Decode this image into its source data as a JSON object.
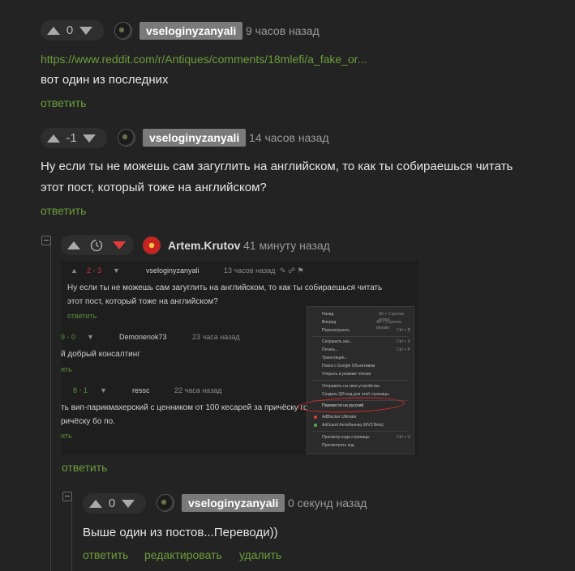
{
  "comments": [
    {
      "score": "0",
      "username": "vseloginyzanyali",
      "time": "9 часов назад",
      "link": "https://www.reddit.com/r/Antiques/comments/18mlefi/a_fake_or...",
      "text": "вот один из последних",
      "reply_label": "ответить"
    },
    {
      "score": "-1",
      "username": "vseloginyzanyali",
      "time": "14 часов назад",
      "text_line1": "Ну если ты не можешь сам загуглить на английском, то как ты собираешься читать",
      "text_line2": "этот пост, который тоже на английском?",
      "reply_label": "ответить"
    },
    {
      "username": "Artem.Krutov",
      "time": "41 минуту назад",
      "reply_label": "ответить",
      "screenshot": {
        "c1_score": "2 - 3",
        "c1_user": "vseloginyzanyali",
        "c1_time": "13 часов назад",
        "c1_l1": "Ну если ты не можешь сам загуглить на английском, то как ты собираешься читать",
        "c1_l2": "этот пост, который тоже на английском?",
        "c1_reply": "ответить",
        "c2_score": "9 - 0",
        "c2_user": "Demonenok73",
        "c2_time": "23 часа назад",
        "c2_text": "й добрый консалтинг",
        "c2_reply": "ить",
        "c3_score": "8 - 1",
        "c3_user": "ressc",
        "c3_time": "22 часа назад",
        "c3_l1": "ть вип-парикмахерский с ценником от 100 кесарей за причёску гор",
        "c3_l2": "ричёску бо по.",
        "c3_reply": "ить",
        "menu": [
          "Назад",
          "Вперед",
          "Перезагрузить",
          "Сохранить как...",
          "Печать...",
          "Трансляция...",
          "Поиск с Google Объективом",
          "Открыть в режиме чтения",
          "Отправить на свои устройства",
          "Создать QR-код для этой страницы",
          "Перевести на русский",
          "AdBlocker Ultimate",
          "AdGuard Антибаннер (МV3 Beta)",
          "Просмотр кода страницы",
          "Просмотреть код"
        ],
        "menu_shortcuts": [
          "Alt + Стрелка влево",
          "Alt + Стрелка вправо",
          "Ctrl + R",
          "Ctrl + S",
          "Ctrl + P",
          "",
          "",
          "",
          "",
          "",
          "",
          "",
          "",
          "Ctrl + U",
          ""
        ]
      }
    },
    {
      "score": "0",
      "username": "vseloginyzanyali",
      "time": "0 секунд назад",
      "text": "Выше один из постов...Переводи))",
      "reply_label": "ответить",
      "edit_label": "редактировать",
      "delete_label": "удалить"
    }
  ],
  "colors": {
    "accent": "#6a9e3a",
    "downvote_active": "#e03c3c",
    "background": "#232323"
  }
}
